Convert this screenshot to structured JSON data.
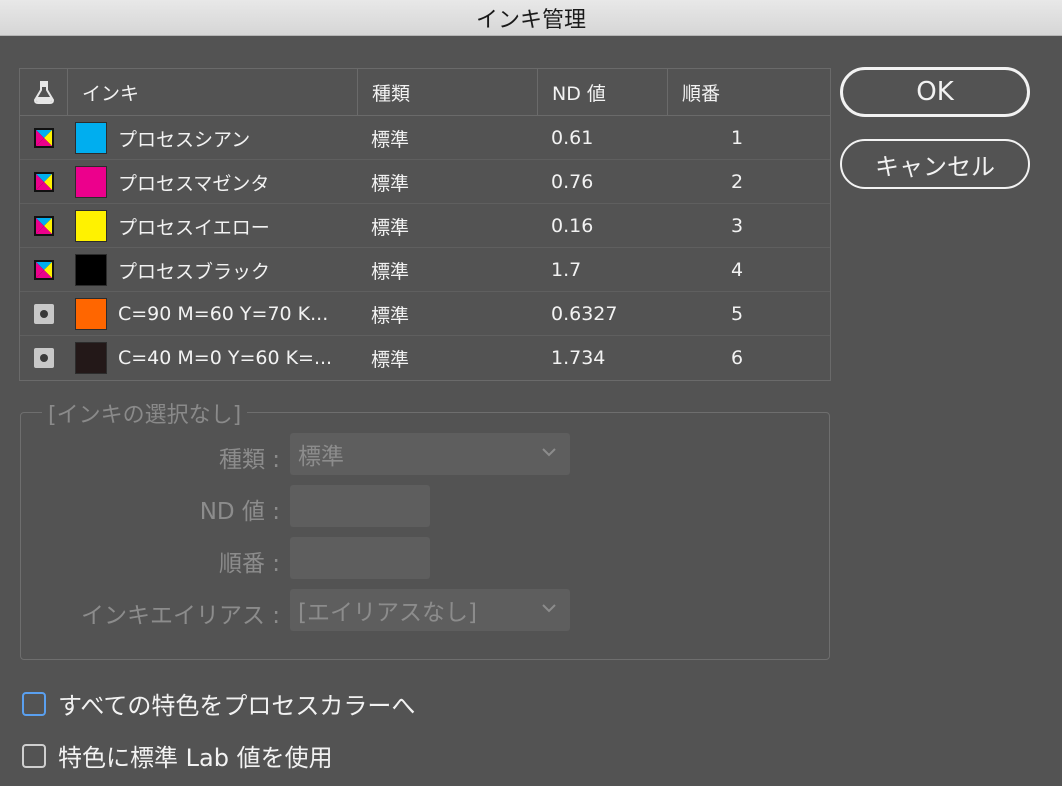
{
  "window": {
    "title": "インキ管理"
  },
  "table": {
    "headers": {
      "ink": "インキ",
      "type": "種類",
      "nd": "ND 値",
      "sequence": "順番"
    },
    "rows": [
      {
        "icon": "cmyk-process-icon",
        "color": "#00aeef",
        "name": "プロセスシアン",
        "type": "標準",
        "nd": "0.61",
        "seq": "1"
      },
      {
        "icon": "cmyk-process-icon",
        "color": "#ec008c",
        "name": "プロセスマゼンタ",
        "type": "標準",
        "nd": "0.76",
        "seq": "2"
      },
      {
        "icon": "cmyk-process-icon",
        "color": "#fff200",
        "name": "プロセスイエロー",
        "type": "標準",
        "nd": "0.16",
        "seq": "3"
      },
      {
        "icon": "cmyk-process-icon",
        "color": "#000000",
        "name": "プロセスブラック",
        "type": "標準",
        "nd": "1.7",
        "seq": "4"
      },
      {
        "icon": "spot-ink-icon",
        "color": "#ff6600",
        "name": "C=90 M=60 Y=70 K...",
        "type": "標準",
        "nd": "0.6327",
        "seq": "5"
      },
      {
        "icon": "spot-ink-icon",
        "color": "#231818",
        "name": "C=40 M=0 Y=60 K=...",
        "type": "標準",
        "nd": "1.734",
        "seq": "6"
      }
    ]
  },
  "buttons": {
    "ok": "OK",
    "cancel": "キャンセル"
  },
  "detail": {
    "title": "[インキの選択なし]",
    "type_label": "種類 :",
    "type_value": "標準",
    "nd_label": "ND 値 :",
    "nd_value": "",
    "sequence_label": "順番 :",
    "sequence_value": "",
    "alias_label": "インキエイリアス :",
    "alias_value": "[エイリアスなし]"
  },
  "options": {
    "all_spots_to_process": "すべての特色をプロセスカラーへ",
    "use_lab_for_spots": "特色に標準 Lab 値を使用"
  }
}
